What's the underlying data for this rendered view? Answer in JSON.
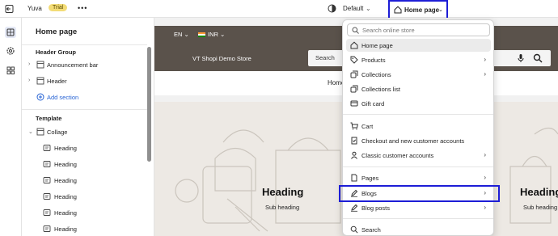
{
  "topbar": {
    "store_name": "Yuva",
    "trial_badge": "Trial",
    "more_label": "•••",
    "theme_label": "Default",
    "page_label": "Home page"
  },
  "sidebar": {
    "title": "Home page",
    "header_group_label": "Header Group",
    "header_items": [
      {
        "label": "Announcement bar"
      },
      {
        "label": "Header"
      }
    ],
    "add_section_label": "Add section",
    "template_label": "Template",
    "template_items": [
      {
        "label": "Collage"
      },
      {
        "label": "Heading"
      },
      {
        "label": "Heading"
      },
      {
        "label": "Heading"
      },
      {
        "label": "Heading"
      },
      {
        "label": "Heading"
      },
      {
        "label": "Heading"
      }
    ]
  },
  "preview": {
    "language": "EN",
    "currency": "INR",
    "store_title": "VT Shopi Demo Store",
    "search_placeholder": "Search",
    "nav_home": "Home",
    "hero_heading": "Heading",
    "hero_subheading": "Sub heading"
  },
  "menu": {
    "search_placeholder": "Search online store",
    "groups": [
      {
        "items": [
          {
            "label": "Home page",
            "icon": "home-icon",
            "selected": true,
            "submenu": false
          },
          {
            "label": "Products",
            "icon": "tag-icon",
            "submenu": true
          },
          {
            "label": "Collections",
            "icon": "collections-icon",
            "submenu": true
          },
          {
            "label": "Collections list",
            "icon": "collections-icon",
            "submenu": false
          },
          {
            "label": "Gift card",
            "icon": "gift-card-icon",
            "submenu": false
          }
        ]
      },
      {
        "items": [
          {
            "label": "Cart",
            "icon": "cart-icon",
            "submenu": false
          },
          {
            "label": "Checkout and new customer accounts",
            "icon": "checkout-icon",
            "submenu": false
          },
          {
            "label": "Classic customer accounts",
            "icon": "person-icon",
            "submenu": true
          }
        ]
      },
      {
        "items": [
          {
            "label": "Pages",
            "icon": "page-icon",
            "submenu": true
          },
          {
            "label": "Blogs",
            "icon": "blog-icon",
            "submenu": true
          },
          {
            "label": "Blog posts",
            "icon": "blog-icon",
            "submenu": true
          }
        ]
      },
      {
        "items": [
          {
            "label": "Search",
            "icon": "search-icon",
            "submenu": false
          }
        ]
      }
    ]
  },
  "colors": {
    "highlight_border": "#1d1dd6",
    "store_header_bg": "#5a524b",
    "trial_badge_bg": "#f3dc76",
    "link": "#2763d4"
  }
}
